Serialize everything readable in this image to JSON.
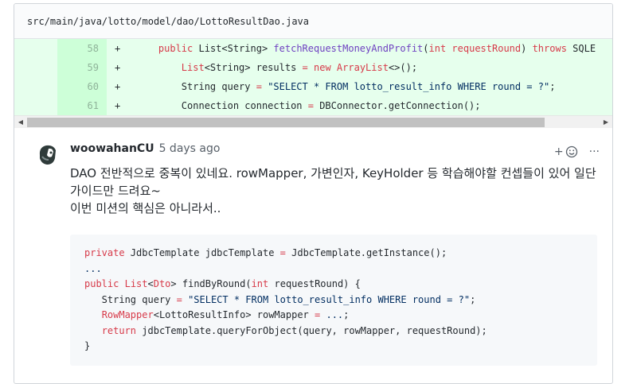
{
  "file": {
    "path": "src/main/java/lotto/model/dao/LottoResultDao.java"
  },
  "diff": {
    "lines": [
      {
        "number": "58",
        "marker": "+"
      },
      {
        "number": "59",
        "marker": "+"
      },
      {
        "number": "60",
        "marker": "+"
      },
      {
        "number": "61",
        "marker": "+"
      }
    ]
  },
  "comment": {
    "author": "woowahanCU",
    "timestamp": "5 days ago",
    "reaction_label": "+",
    "more_label": "···",
    "body_line1": "DAO 전반적으로 중복이 있네요. rowMapper, 가변인자, KeyHolder 등 학습해야할 컨셉들이 있어 일단 가이드만 드려요~",
    "body_line2": "이번 미션의 핵심은 아니라서.."
  },
  "colors": {
    "added_line_bg": "#e6ffed",
    "added_number_bg": "#cdffd8",
    "keyword": "#d73a49",
    "type": "#6f42c1",
    "string": "#032f62",
    "snippet_bg": "#f6f8fa"
  },
  "icons": [
    "smiley-icon",
    "kebab-icon",
    "scroll-left-icon",
    "scroll-right-icon",
    "avatar-icon"
  ]
}
